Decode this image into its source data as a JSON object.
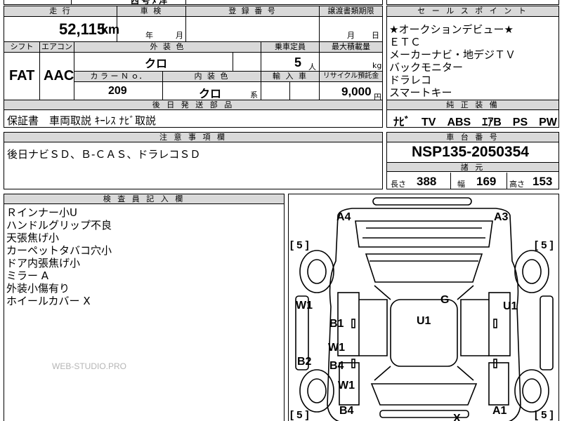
{
  "top": {
    "partial_text": "西 号 ﾒ 洋",
    "headers": {
      "mileage": "走 行",
      "inspection": "車 検",
      "registration": "登 録 番 号",
      "transfer_deadline": "譲渡書類期限",
      "shift": "シフト",
      "aircon": "エアコン",
      "exterior_color": "外 装 色",
      "capacity": "乗車定員",
      "max_load": "最大積載量",
      "color_no": "カ ラ ー Ｎ ｏ．",
      "interior_color": "内 装 色",
      "import": "輸 入 車",
      "recycle": "リサイクル預託金"
    },
    "mileage_value": "52,115",
    "mileage_unit": "km",
    "inspection_year": "年",
    "inspection_month": "月",
    "transfer_month": "月",
    "transfer_day": "日",
    "shift_value": "FAT",
    "aircon_value": "AAC",
    "exterior_color_value": "クロ",
    "capacity_value": "5",
    "capacity_unit": "人",
    "max_load_unit": "kg",
    "color_no_value": "209",
    "interior_color_value": "クロ",
    "interior_suffix": "系",
    "recycle_value": "9,000",
    "recycle_unit": "円"
  },
  "sales_points": {
    "header": "セ ー ル ス ポ イ ン ト",
    "items": [
      "★オークションデビュー★",
      "ＥＴＣ",
      "メーカーナビ・地デジＴＶ",
      "バックモニター",
      "ドラレコ",
      "スマートキー"
    ]
  },
  "delivery_parts": {
    "header": "後 日 発 送 部 品",
    "value": "保証書　車両取説 ｷｰﾚｽ ﾅﾋﾞ取説"
  },
  "genuine_equipment": {
    "header": "純 正 装 備",
    "value": "ﾅﾋﾞ　TV　ABS　ｴｱB　PS　PW"
  },
  "notes": {
    "header": "注 意 事 項 欄",
    "value": "後日ナビＳＤ、Ｂ-ＣＡＳ、ドラレコＳＤ"
  },
  "chassis": {
    "header": "車 台 番 号",
    "value": "NSP135-2050354"
  },
  "specs": {
    "header": "諸 元",
    "length_label": "長さ",
    "length_value": "388",
    "width_label": "幅",
    "width_value": "169",
    "height_label": "高さ",
    "height_value": "153"
  },
  "inspector": {
    "header": "検 査 員 記 入 欄",
    "lines": [
      "Ｒインナー小U",
      "ハンドルグリップ不良",
      "天張焦げ小",
      "カーペットタバコ穴小",
      "ドア内張焦げ小",
      "ミラー A",
      "外装小傷有り",
      "ホイールカバー X"
    ],
    "watermark": "WEB-STUDIO.PRO"
  },
  "diagram": {
    "tire_marks": [
      "[ 5 ]",
      "[ 5 ]",
      "[ 5 ]",
      "[ 5 ]"
    ],
    "labels": [
      "A4",
      "A3",
      "W1",
      "U1",
      "G",
      "U1",
      "B1",
      "W1",
      "B2",
      "B4",
      "W1",
      "B4",
      "A1",
      "X"
    ]
  }
}
